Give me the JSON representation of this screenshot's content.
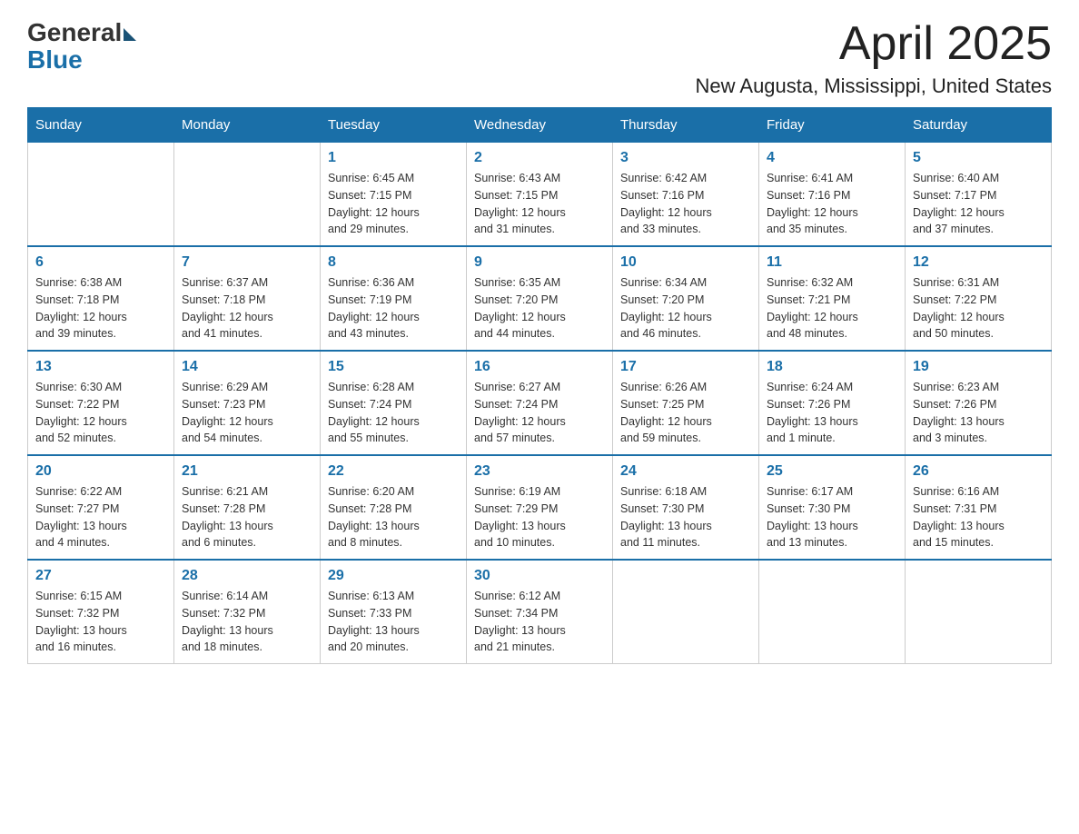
{
  "logo": {
    "general": "General",
    "blue": "Blue"
  },
  "header": {
    "month": "April 2025",
    "location": "New Augusta, Mississippi, United States"
  },
  "weekdays": [
    "Sunday",
    "Monday",
    "Tuesday",
    "Wednesday",
    "Thursday",
    "Friday",
    "Saturday"
  ],
  "weeks": [
    [
      {
        "day": "",
        "info": ""
      },
      {
        "day": "",
        "info": ""
      },
      {
        "day": "1",
        "info": "Sunrise: 6:45 AM\nSunset: 7:15 PM\nDaylight: 12 hours\nand 29 minutes."
      },
      {
        "day": "2",
        "info": "Sunrise: 6:43 AM\nSunset: 7:15 PM\nDaylight: 12 hours\nand 31 minutes."
      },
      {
        "day": "3",
        "info": "Sunrise: 6:42 AM\nSunset: 7:16 PM\nDaylight: 12 hours\nand 33 minutes."
      },
      {
        "day": "4",
        "info": "Sunrise: 6:41 AM\nSunset: 7:16 PM\nDaylight: 12 hours\nand 35 minutes."
      },
      {
        "day": "5",
        "info": "Sunrise: 6:40 AM\nSunset: 7:17 PM\nDaylight: 12 hours\nand 37 minutes."
      }
    ],
    [
      {
        "day": "6",
        "info": "Sunrise: 6:38 AM\nSunset: 7:18 PM\nDaylight: 12 hours\nand 39 minutes."
      },
      {
        "day": "7",
        "info": "Sunrise: 6:37 AM\nSunset: 7:18 PM\nDaylight: 12 hours\nand 41 minutes."
      },
      {
        "day": "8",
        "info": "Sunrise: 6:36 AM\nSunset: 7:19 PM\nDaylight: 12 hours\nand 43 minutes."
      },
      {
        "day": "9",
        "info": "Sunrise: 6:35 AM\nSunset: 7:20 PM\nDaylight: 12 hours\nand 44 minutes."
      },
      {
        "day": "10",
        "info": "Sunrise: 6:34 AM\nSunset: 7:20 PM\nDaylight: 12 hours\nand 46 minutes."
      },
      {
        "day": "11",
        "info": "Sunrise: 6:32 AM\nSunset: 7:21 PM\nDaylight: 12 hours\nand 48 minutes."
      },
      {
        "day": "12",
        "info": "Sunrise: 6:31 AM\nSunset: 7:22 PM\nDaylight: 12 hours\nand 50 minutes."
      }
    ],
    [
      {
        "day": "13",
        "info": "Sunrise: 6:30 AM\nSunset: 7:22 PM\nDaylight: 12 hours\nand 52 minutes."
      },
      {
        "day": "14",
        "info": "Sunrise: 6:29 AM\nSunset: 7:23 PM\nDaylight: 12 hours\nand 54 minutes."
      },
      {
        "day": "15",
        "info": "Sunrise: 6:28 AM\nSunset: 7:24 PM\nDaylight: 12 hours\nand 55 minutes."
      },
      {
        "day": "16",
        "info": "Sunrise: 6:27 AM\nSunset: 7:24 PM\nDaylight: 12 hours\nand 57 minutes."
      },
      {
        "day": "17",
        "info": "Sunrise: 6:26 AM\nSunset: 7:25 PM\nDaylight: 12 hours\nand 59 minutes."
      },
      {
        "day": "18",
        "info": "Sunrise: 6:24 AM\nSunset: 7:26 PM\nDaylight: 13 hours\nand 1 minute."
      },
      {
        "day": "19",
        "info": "Sunrise: 6:23 AM\nSunset: 7:26 PM\nDaylight: 13 hours\nand 3 minutes."
      }
    ],
    [
      {
        "day": "20",
        "info": "Sunrise: 6:22 AM\nSunset: 7:27 PM\nDaylight: 13 hours\nand 4 minutes."
      },
      {
        "day": "21",
        "info": "Sunrise: 6:21 AM\nSunset: 7:28 PM\nDaylight: 13 hours\nand 6 minutes."
      },
      {
        "day": "22",
        "info": "Sunrise: 6:20 AM\nSunset: 7:28 PM\nDaylight: 13 hours\nand 8 minutes."
      },
      {
        "day": "23",
        "info": "Sunrise: 6:19 AM\nSunset: 7:29 PM\nDaylight: 13 hours\nand 10 minutes."
      },
      {
        "day": "24",
        "info": "Sunrise: 6:18 AM\nSunset: 7:30 PM\nDaylight: 13 hours\nand 11 minutes."
      },
      {
        "day": "25",
        "info": "Sunrise: 6:17 AM\nSunset: 7:30 PM\nDaylight: 13 hours\nand 13 minutes."
      },
      {
        "day": "26",
        "info": "Sunrise: 6:16 AM\nSunset: 7:31 PM\nDaylight: 13 hours\nand 15 minutes."
      }
    ],
    [
      {
        "day": "27",
        "info": "Sunrise: 6:15 AM\nSunset: 7:32 PM\nDaylight: 13 hours\nand 16 minutes."
      },
      {
        "day": "28",
        "info": "Sunrise: 6:14 AM\nSunset: 7:32 PM\nDaylight: 13 hours\nand 18 minutes."
      },
      {
        "day": "29",
        "info": "Sunrise: 6:13 AM\nSunset: 7:33 PM\nDaylight: 13 hours\nand 20 minutes."
      },
      {
        "day": "30",
        "info": "Sunrise: 6:12 AM\nSunset: 7:34 PM\nDaylight: 13 hours\nand 21 minutes."
      },
      {
        "day": "",
        "info": ""
      },
      {
        "day": "",
        "info": ""
      },
      {
        "day": "",
        "info": ""
      }
    ]
  ]
}
